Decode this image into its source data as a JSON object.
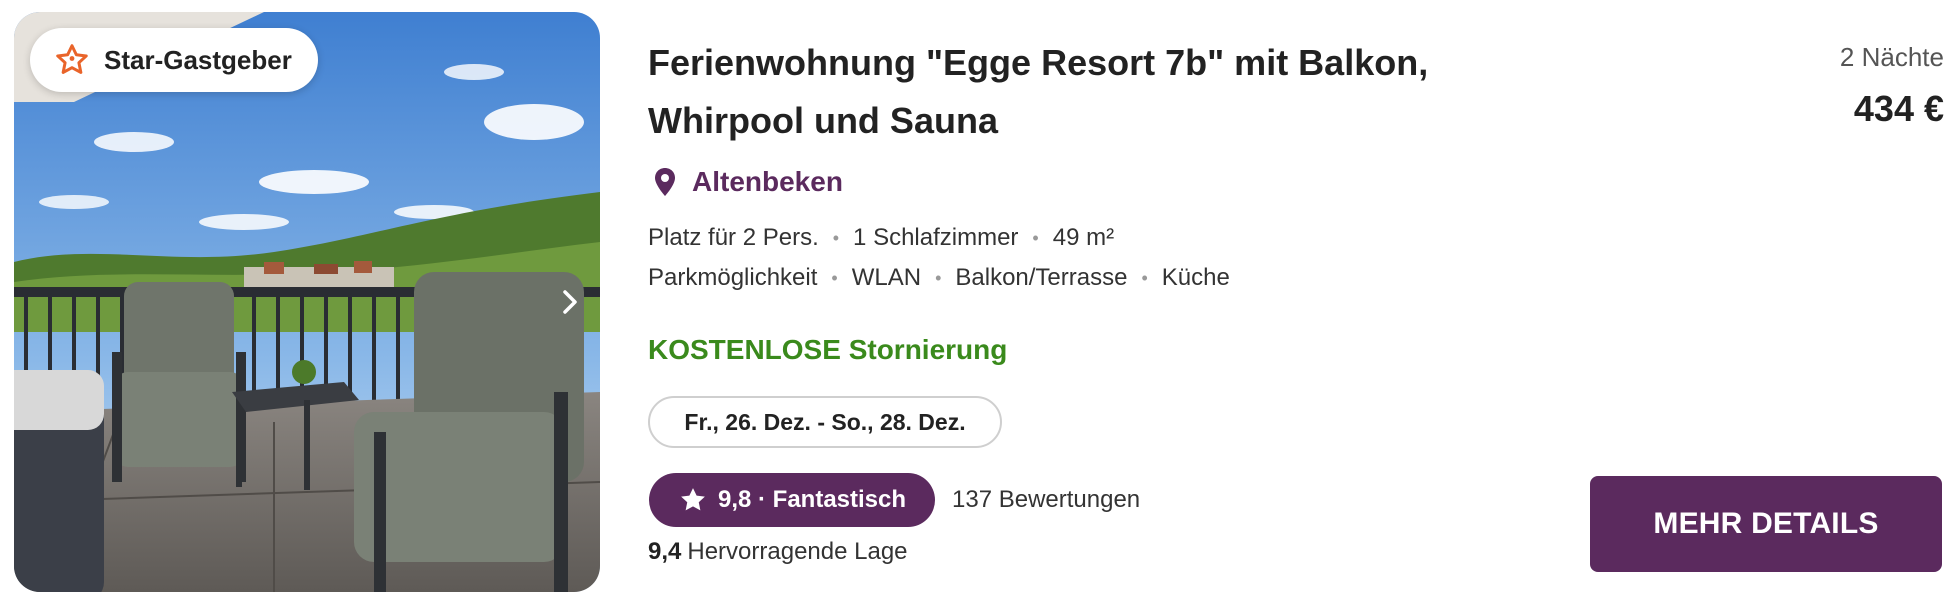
{
  "listing": {
    "badge": {
      "label": "Star-Gastgeber",
      "icon": "star-outline-icon",
      "icon_color": "#e9642a"
    },
    "photo": {
      "alt": "Balkon mit Liegestühlen und Blick auf Altenbeken"
    },
    "title_line1": "Ferienwohnung \"Egge Resort 7b\" mit Balkon,",
    "title_line2": "Whirpool und Sauna",
    "location": "Altenbeken",
    "facts_row1": [
      "Platz für 2 Pers.",
      "1 Schlafzimmer",
      "49 m²"
    ],
    "facts_row2": [
      "Parkmöglichkeit",
      "WLAN",
      "Balkon/Terrasse",
      "Küche"
    ],
    "cancellation": "KOSTENLOSE Stornierung",
    "dates": "Fr., 26. Dez. - So., 28. Dez.",
    "rating_label": "9,8 · Fantastisch",
    "reviews": "137 Bewertungen",
    "location_score": "9,4",
    "location_score_label": "Hervorragende Lage",
    "nights": "2 Nächte",
    "price": "434 €",
    "cta_label": "MEHR DETAILS"
  },
  "colors": {
    "brand": "#5b2a5e",
    "success": "#3a8a1c",
    "badge_star": "#e9642a"
  }
}
